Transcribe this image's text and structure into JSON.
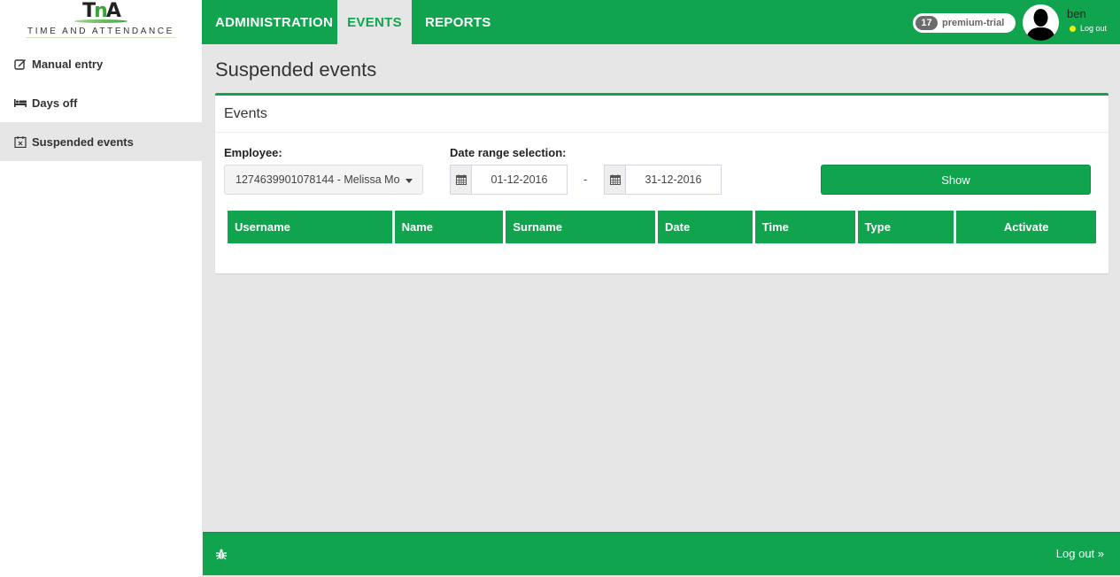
{
  "app": {
    "logo_mark": "TnA",
    "logo_subtitle": "TIME AND ATTENDANCE"
  },
  "sidebar": {
    "items": [
      {
        "label": "Manual entry",
        "icon": "edit-icon",
        "active": false
      },
      {
        "label": "Days off",
        "icon": "bed-icon",
        "active": false
      },
      {
        "label": "Suspended events",
        "icon": "calendar-times-icon",
        "active": true
      }
    ]
  },
  "topnav": {
    "tabs": [
      {
        "label": "ADMINISTRATION",
        "active": false
      },
      {
        "label": "EVENTS",
        "active": true
      },
      {
        "label": "REPORTS",
        "active": false
      }
    ]
  },
  "user": {
    "badge_count": "17",
    "plan": "premium-trial",
    "name": "ben",
    "logout": "Log out",
    "status_color": "#f4f400"
  },
  "page": {
    "title": "Suspended events"
  },
  "panel": {
    "title": "Events",
    "employee_label": "Employee:",
    "employee_value": "1274639901078144 - Melissa Mo",
    "date_label": "Date range selection:",
    "date_from": "01-12-2016",
    "date_separator": "-",
    "date_to": "31-12-2016",
    "show_button": "Show"
  },
  "table": {
    "columns": [
      "Username",
      "Name",
      "Surname",
      "Date",
      "Time",
      "Type",
      "Activate"
    ],
    "rows": []
  },
  "footer": {
    "logout": "Log out »"
  },
  "colors": {
    "brand": "#10a44f",
    "background": "#e6e6e6"
  }
}
